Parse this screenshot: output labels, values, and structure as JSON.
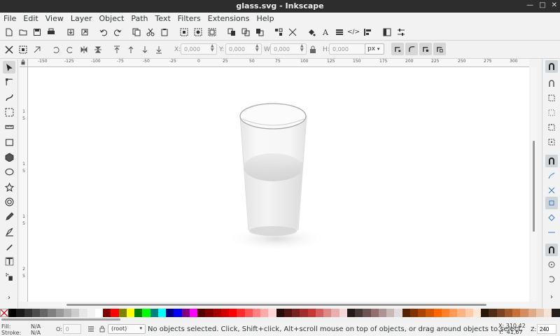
{
  "window": {
    "title": "glass.svg - Inkscape"
  },
  "menu": [
    "File",
    "Edit",
    "View",
    "Layer",
    "Object",
    "Path",
    "Text",
    "Filters",
    "Extensions",
    "Help"
  ],
  "commands": [
    "new-icon",
    "open-icon",
    "save-icon",
    "print-icon",
    "import-icon",
    "export-icon",
    "undo-icon",
    "redo-icon",
    "copy-icon",
    "cut-icon",
    "paste-icon",
    "zoom-selection-icon",
    "zoom-drawing-icon",
    "zoom-page-icon",
    "duplicate-icon",
    "clone-icon",
    "unlink-clone-icon",
    "group-icon",
    "ungroup-icon",
    "fill-stroke-icon",
    "text-font-icon",
    "layers-icon",
    "xml-editor-icon",
    "align-icon",
    "preferences-icon",
    "document-properties-icon"
  ],
  "controls": {
    "x_label": "X:",
    "x_value": "0,000",
    "y_label": "Y:",
    "y_value": "0,000",
    "w_label": "W:",
    "w_value": "0,000",
    "h_label": "H:",
    "h_value": "0,000",
    "unit": "px"
  },
  "ruler_h": [
    "-150",
    "-125",
    "-100",
    "-75",
    "-50",
    "-25",
    "0",
    "25",
    "50",
    "75",
    "100",
    "125",
    "150",
    "175",
    "200",
    "225",
    "250",
    "275",
    "300"
  ],
  "ruler_v": [
    "1",
    "5",
    "1",
    "5",
    "1",
    "5",
    "2",
    "5",
    "2"
  ],
  "status": {
    "fill_label": "Fill:",
    "fill_value": "N/A",
    "stroke_label": "Stroke:",
    "stroke_value": "N/A",
    "opacity_label": "O:",
    "opacity_value": "0",
    "layer": "(root)",
    "message": "No objects selected. Click, Shift+click, Alt+scroll mouse on top of objects, or drag around objects to select.",
    "x_label": "X:",
    "x_value": "310,42",
    "y_label": "Y:",
    "y_value": "41,67",
    "zoom_label": "Z:",
    "zoom_value": "240"
  },
  "palette": [
    "#000000",
    "#1a1a1a",
    "#333333",
    "#4d4d4d",
    "#666666",
    "#808080",
    "#999999",
    "#b3b3b3",
    "#cccccc",
    "#e6e6e6",
    "#f2f2f2",
    "#ffffff",
    "#800000",
    "#ff0000",
    "#808000",
    "#ffff00",
    "#008000",
    "#00ff00",
    "#008080",
    "#00ffff",
    "#000080",
    "#0000ff",
    "#800080",
    "#ff00ff",
    "#550000",
    "#800000",
    "#aa0000",
    "#d40000",
    "#ff0000",
    "#ff2a2a",
    "#ff5555",
    "#ff8080",
    "#ffaaaa",
    "#ffd5d5",
    "#280b0b",
    "#501616",
    "#782121",
    "#a02c2c",
    "#c83737",
    "#d35f5f",
    "#de8787",
    "#e9afaf",
    "#f4d7d7",
    "#241c1c",
    "#483737",
    "#6c5353",
    "#916f6f",
    "#ac9393",
    "#c8b7b7",
    "#e3dbdb",
    "#552200",
    "#803300",
    "#aa4400",
    "#d45500",
    "#ff6600",
    "#ff7f2a",
    "#ff9955",
    "#ffb380",
    "#ffccaa",
    "#ffe6d5",
    "#28170b",
    "#502d16",
    "#784421",
    "#a05a2c",
    "#c87137",
    "#d38d5f",
    "#deaa87",
    "#e9c6af",
    "#f4e3d7",
    "#241f1c"
  ]
}
